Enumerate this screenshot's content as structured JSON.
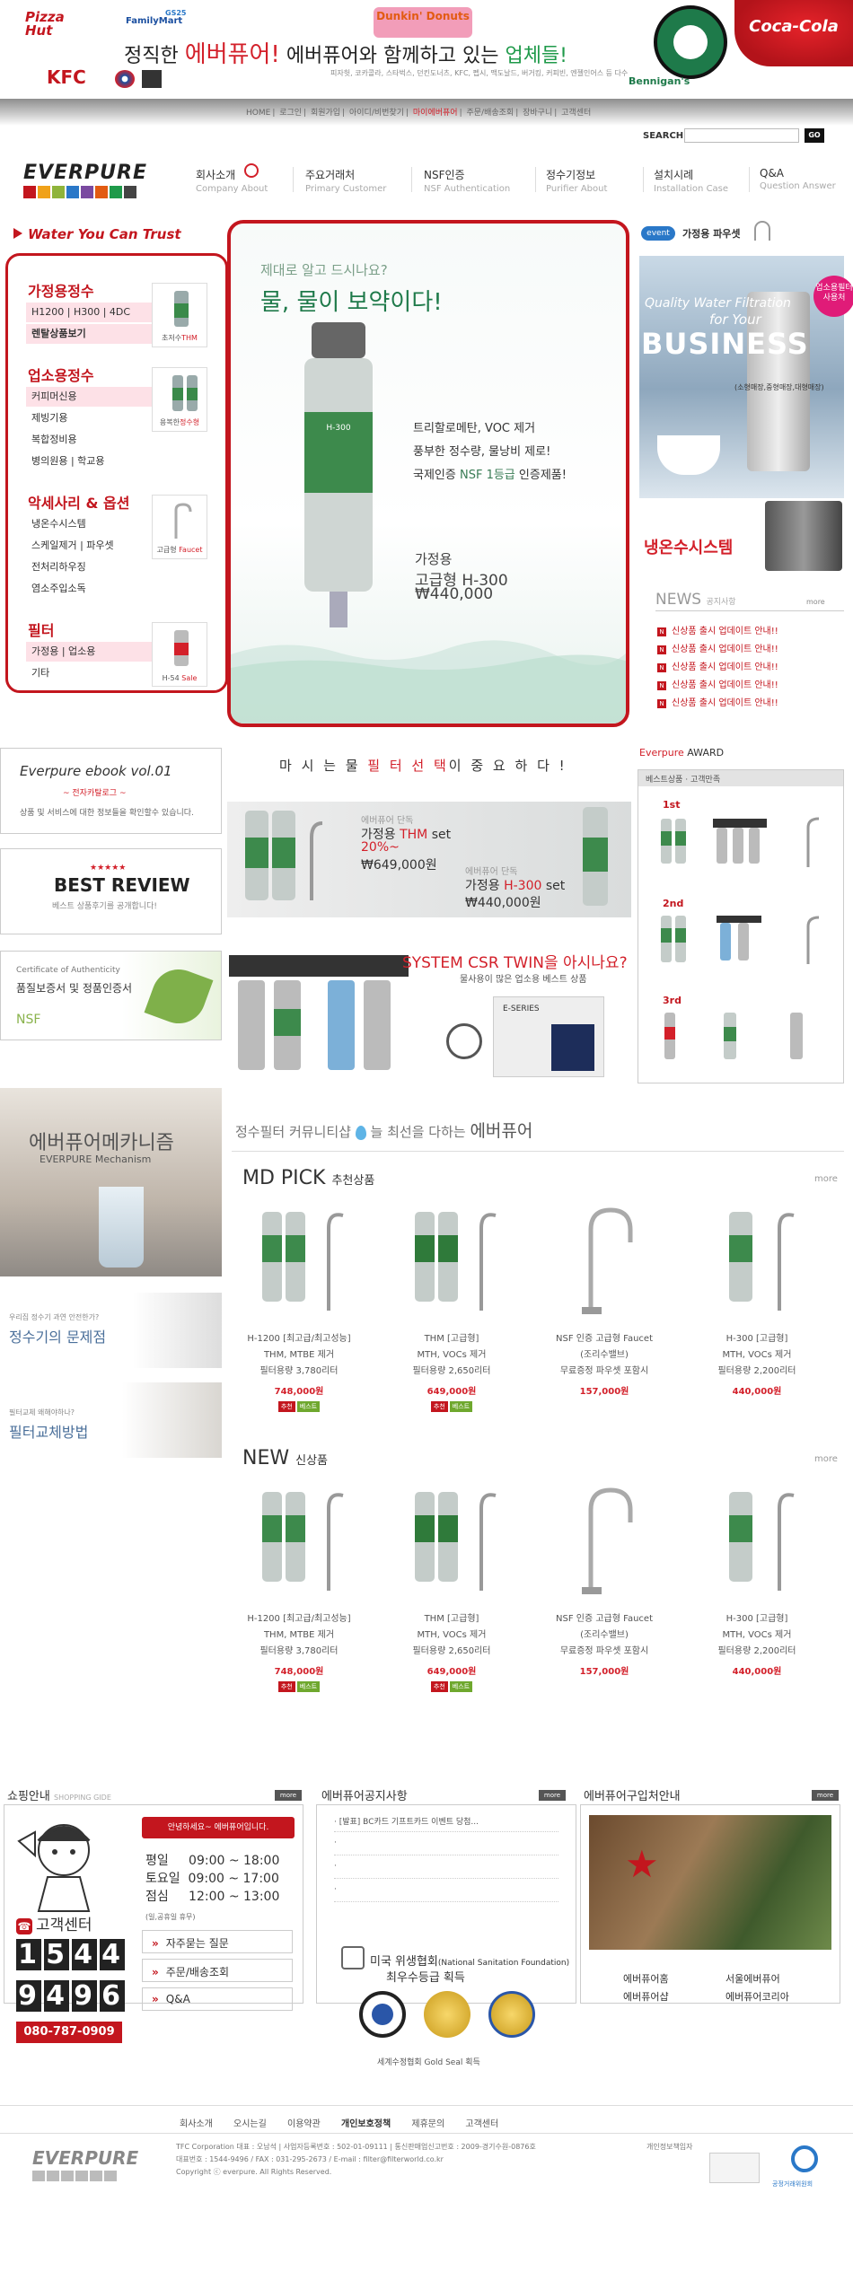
{
  "banner": {
    "brands": [
      "Pizza Hut",
      "FamilyMart",
      "KFC",
      "Dunkin' Donuts",
      "Starbucks Coffee",
      "Coca-Cola",
      "Bennigan's"
    ],
    "gs25": "GS25",
    "headline_pre": "정직한 ",
    "headline_brand": "에버퓨어!",
    "headline_mid": " 에버퓨어와 함께하고 있는 ",
    "headline_end": "업체들!",
    "subline": "피자헛, 코카콜라, 스타벅스, 던킨도너츠, KFC, 펩시, 맥도날드, 버거킹, 커피빈, 엔젤인어스 등 다수"
  },
  "toplinks": [
    "HOME",
    "로그인",
    "회원가입",
    "아이디/비번찾기",
    "마이에버퓨어",
    "주문/배송조회",
    "장바구니",
    "고객센터"
  ],
  "search": {
    "label": "SEARCH",
    "go": "GO"
  },
  "nav": [
    {
      "ko": "회사소개",
      "en": "Company About"
    },
    {
      "ko": "주요거래처",
      "en": "Primary Customer"
    },
    {
      "ko": "NSF인증",
      "en": "NSF Authentication"
    },
    {
      "ko": "정수기정보",
      "en": "Purifier About"
    },
    {
      "ko": "설치시례",
      "en": "Installation Case"
    },
    {
      "ko": "Q&A",
      "en": "Question Answer"
    }
  ],
  "logo_text": "EVERPURE",
  "slogan": "Water You Can Trust",
  "categories": {
    "home": {
      "title": "가정용정수",
      "items": [
        "H1200 | H300 | 4DC",
        "렌탈상품보기"
      ],
      "thumb_label": "초저수",
      "thumb_em": "THM"
    },
    "biz": {
      "title": "업소용정수",
      "items": [
        "커피머신용",
        "제빙기용",
        "복합정비용",
        "병의원용 | 학교용"
      ],
      "thumb_label": "용복한",
      "thumb_em": "정수형"
    },
    "acc": {
      "title": "악세사리 & 옵션",
      "items": [
        "냉온수시스템",
        "스케일제거 | 파우셋",
        "전처리하우징",
        "염소주입소독"
      ],
      "thumb_label": "고급형",
      "thumb_em": "Faucet"
    },
    "filter": {
      "title": "필터",
      "items": [
        "가정용 | 업소용",
        "기타"
      ],
      "thumb_label": "H-54",
      "thumb_em": "Sale"
    }
  },
  "hero": {
    "sub": "제대로 알고 드시나요?",
    "title": "물, 물이 보약이다!",
    "copy1": "트리할로메탄, VOC 제거",
    "copy2": "풍부한 정수량,  물낭비 제로!",
    "copy3_pre": "국제인증 ",
    "copy3_em": "NSF 1등급",
    "copy3_post": " 인증제품!",
    "model1": "가정용",
    "model2": "고급형 H-300",
    "price": "₩440,000",
    "product_label": "H-300"
  },
  "event": {
    "tag": "event",
    "text": "가정용 파우셋"
  },
  "biz_ad": {
    "line1": "Quality Water Filtration",
    "line2": "for Your",
    "line3": "BUSINESS",
    "sub": "(소형매장,중형매장,대형매장)",
    "badge": "업소용필터 사용처"
  },
  "naeon": "냉온수시스템",
  "news": {
    "title": "NEWS",
    "sub": "공지사항",
    "more": "more",
    "items": [
      "신상품 출시 업데이트 안내!!",
      "신상품 출시 업데이트 안내!!",
      "신상품 출시 업데이트 안내!!",
      "신상품 출시 업데이트 안내!!",
      "신상품 출시 업데이트 안내!!"
    ]
  },
  "ebook": {
    "t1": "Everpure ebook vol.01",
    "t2": "~ 전자카탈로그 ~",
    "t3": "상품 및 서비스에 대한 정보들을 확인할수 있습니다."
  },
  "review": {
    "stars": "★★★★★",
    "title": "BEST REVIEW",
    "sub": "베스트 상품후기를 공개합니다!"
  },
  "cert": {
    "t1": "Certificate of Authenticity",
    "t2": "품질보증서 및 정품인증서",
    "t3": "",
    "t4": "NSF"
  },
  "importance": {
    "pre": "마 시 는  물  ",
    "em": "필 터 선 택",
    "post": "이  중 요 하 다 !"
  },
  "thm_ban": {
    "s1": "에버퓨어 단독",
    "m1_pre": "가정용 ",
    "m1_em": "THM",
    "m1_post": " set",
    "pct": "20%~",
    "p1": "₩649,000원",
    "s2": "에버퓨어 단독",
    "m2_pre": "가정용 ",
    "m2_em": "H-300",
    "m2_post": " set",
    "p2": "₩440,000원"
  },
  "csr": {
    "title": "SYSTEM CSR TWIN을 아시나요?",
    "sub": "물사용이 많은 업소용 베스트 상품",
    "label": "E-SERIES"
  },
  "award": {
    "title_em": "Everpure",
    "title": " AWARD",
    "head": "베스트상품 · 고객만족",
    "ranks": [
      "1st",
      "2nd",
      "3rd"
    ]
  },
  "mech": {
    "t1": "에버퓨어메카니즘",
    "t2": "EVERPURE Mechanism"
  },
  "prob": {
    "s": "우리집 정수기 과연 안전한가?",
    "t": "정수기의 문제점"
  },
  "change": {
    "s": "필터교체 왜해야하나?",
    "t": "필터교체방법"
  },
  "community": {
    "pre": "정수필터 커뮤니티샵 ",
    "mid": "늘 최선을 다하는 ",
    "em": "에버퓨어"
  },
  "md_pick": {
    "title": "MD PICK",
    "sub": "추천상품",
    "more": "more"
  },
  "new_items": {
    "title": "NEW",
    "sub": "신상품",
    "more": "more"
  },
  "products": [
    {
      "n1": "H-1200 [최고급/최고성능]",
      "n2": "THM, MTBE 제거",
      "n3": "필터용량 3,780리터",
      "price": "748,000원",
      "tags": [
        "추천",
        "베스트"
      ]
    },
    {
      "n1": "THM [고급형]",
      "n2": "MTH, VOCs 제거",
      "n3": "필터용량 2,650리터",
      "price": "649,000원",
      "tags": [
        "추천",
        "베스트"
      ]
    },
    {
      "n1": "NSF 인증 고급형 Faucet",
      "n2": "(조리수밸브)",
      "n3": "무료증정 파우셋 포함시",
      "price": "157,000원",
      "tags": []
    },
    {
      "n1": "H-300 [고급형]",
      "n2": "MTH, VOCs 제거",
      "n3": "필터용량 2,200리터",
      "price": "440,000원",
      "tags": []
    }
  ],
  "shop": {
    "title": "쇼핑안내",
    "sub": "SHOPPING GIDE",
    "more": "more",
    "welcome": "안녕하세요~ 에버퓨어입니다.",
    "hours": [
      {
        "d": "평일",
        "t": "09:00  ~  18:00"
      },
      {
        "d": "토요일",
        "t": "09:00  ~  17:00"
      },
      {
        "d": "점심",
        "t": "12:00  ~  13:00"
      }
    ],
    "note": "(일,공휴일 휴무)",
    "links": [
      "자주묻는 질문",
      "주문/배송조회",
      "Q&A"
    ],
    "cc_title": "고객센터",
    "digits1": [
      "1",
      "5",
      "4",
      "4"
    ],
    "digits2": [
      "9",
      "4",
      "9",
      "6"
    ],
    "mobile": "080-787-0909"
  },
  "notice": {
    "title": "에버퓨어공지사항",
    "more": "more",
    "items": [
      "[발표] BC카드 기프트카드 이벤트 당첨..."
    ],
    "nsf_t1": "미국 위생협회",
    "nsf_t1s": "(National Sanitation Foundation)",
    "nsf_t2": "최우수등급 획득",
    "seal": "세계수정협회 Gold Seal 획득"
  },
  "stores": {
    "title": "에버퓨어구입처안내",
    "more": "more",
    "items": [
      "에버퓨어홈",
      "서울에버퓨어",
      "에버퓨어샵",
      "에버퓨어코리아"
    ]
  },
  "footer": {
    "links": [
      "회사소개",
      "오시는길",
      "이용약관",
      "개인보호정책",
      "제휴문의",
      "고객센터"
    ],
    "addr1": "TFC Corporation 대표 : 오남석  |  사업자등록번호 : 502-01-09111  |  통신판매업신고번호 : 2009-경기수원-0876호",
    "addr2": "대표번호 : 1544-9496 / FAX : 031-295-2673 / E-mail : filter@filterworld.co.kr",
    "addr3": "Copyright ⓒ everpure.  All Rights Reserved.",
    "pi": "개인정보책임자",
    "ftc": "공정거래위원회"
  }
}
